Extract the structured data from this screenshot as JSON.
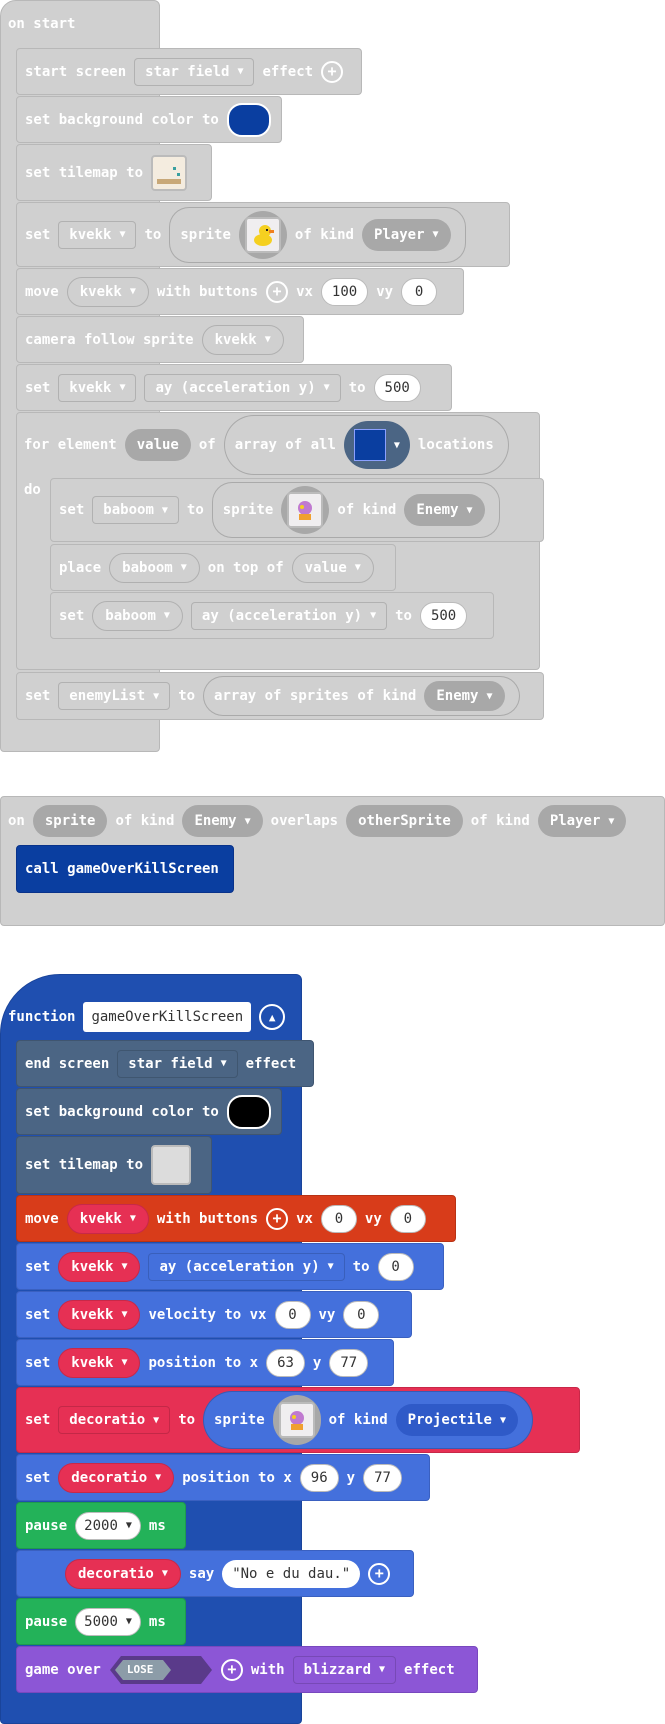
{
  "on_start": {
    "hat_label": "on start",
    "start_screen": {
      "label1": "start screen",
      "effect": "star field",
      "label2": "effect"
    },
    "set_bg": {
      "label": "set background color to",
      "color": "#0a3ea0"
    },
    "set_tilemap": {
      "label": "set tilemap to"
    },
    "set_sprite": {
      "set": "set",
      "var": "kvekk",
      "to": "to",
      "sprite": "sprite",
      "of_kind": "of kind",
      "kind": "Player"
    },
    "move": {
      "label": "move",
      "var": "kvekk",
      "with_buttons": "with buttons",
      "vx": "vx",
      "vx_val": "100",
      "vy": "vy",
      "vy_val": "0"
    },
    "camera": {
      "label": "camera follow sprite",
      "var": "kvekk"
    },
    "set_ay": {
      "set": "set",
      "var": "kvekk",
      "prop": "ay (acceleration y)",
      "to": "to",
      "value": "500"
    },
    "for_element": {
      "label": "for element",
      "var": "value",
      "of": "of",
      "array_of_all": "array of all",
      "tile_color": "#0a3ea0",
      "locations": "locations",
      "do": "do"
    },
    "inner_set_sprite": {
      "set": "set",
      "var": "baboom",
      "to": "to",
      "sprite": "sprite",
      "of_kind": "of kind",
      "kind": "Enemy"
    },
    "place": {
      "label": "place",
      "var": "baboom",
      "on_top_of": "on top of",
      "value": "value"
    },
    "inner_set_ay": {
      "set": "set",
      "var": "baboom",
      "prop": "ay (acceleration y)",
      "to": "to",
      "value": "500"
    },
    "set_enemylist": {
      "set": "set",
      "var": "enemyList",
      "to": "to",
      "array_label": "array of sprites of kind",
      "kind": "Enemy"
    }
  },
  "overlap": {
    "on": "on",
    "sprite": "sprite",
    "of_kind": "of kind",
    "kind1": "Enemy",
    "overlaps": "overlaps",
    "other": "otherSprite",
    "of_kind2": "of kind",
    "kind2": "Player",
    "call_label": "call gameOverKillScreen"
  },
  "function_block": {
    "keyword": "function",
    "name": "gameOverKillScreen",
    "end_screen": {
      "label1": "end screen",
      "effect": "star field",
      "label2": "effect"
    },
    "set_bg": {
      "label": "set background color to",
      "color": "#000000"
    },
    "set_tilemap": {
      "label": "set tilemap to"
    },
    "move": {
      "label": "move",
      "var": "kvekk",
      "with_buttons": "with buttons",
      "vx": "vx",
      "vx_val": "0",
      "vy": "vy",
      "vy_val": "0"
    },
    "set_ay": {
      "set": "set",
      "var": "kvekk",
      "prop": "ay (acceleration y)",
      "to": "to",
      "value": "0"
    },
    "set_velocity": {
      "set": "set",
      "var": "kvekk",
      "label": "velocity to vx",
      "vx_val": "0",
      "vy": "vy",
      "vy_val": "0"
    },
    "set_position": {
      "set": "set",
      "var": "kvekk",
      "label": "position to x",
      "x_val": "63",
      "y": "y",
      "y_val": "77"
    },
    "set_decor": {
      "set": "set",
      "var": "decoratio",
      "to": "to",
      "sprite": "sprite",
      "of_kind": "of kind",
      "kind": "Projectile"
    },
    "set_decor_pos": {
      "set": "set",
      "var": "decoratio",
      "label": "position to x",
      "x_val": "96",
      "y": "y",
      "y_val": "77"
    },
    "pause1": {
      "label": "pause",
      "value": "2000",
      "unit": "ms"
    },
    "say": {
      "var": "decoratio",
      "label": "say",
      "text": "\"No e du dau.\""
    },
    "pause2": {
      "label": "pause",
      "value": "5000",
      "unit": "ms"
    },
    "game_over": {
      "label": "game over",
      "badge": "LOSE",
      "with": "with",
      "effect": "blizzard",
      "label2": "effect"
    }
  }
}
